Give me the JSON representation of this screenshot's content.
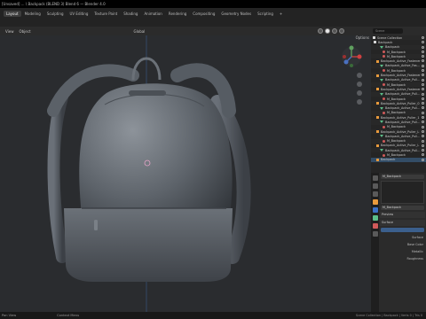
{
  "titlebar": {
    "text": "[Unsaved] ... \\ Backpack (BLEND 3) Blend 6 — Blender 4.0"
  },
  "workspaces": [
    "Layout",
    "Modeling",
    "Sculpting",
    "UV Editing",
    "Texture Paint",
    "Shading",
    "Animation",
    "Rendering",
    "Compositing",
    "Geometry Nodes",
    "Scripting",
    "+"
  ],
  "active_workspace": "Layout",
  "context": {
    "view": "View",
    "object": "Object",
    "orientation": "Global",
    "options": "Options"
  },
  "outliner": {
    "search_placeholder": "Scene",
    "rows": [
      {
        "label": "Scene Collection",
        "icon": "collection-icon",
        "selected": false
      },
      {
        "label": "Backpack",
        "icon": "collection-icon",
        "selected": false
      },
      {
        "label": "Backpack",
        "icon": "mesh-icon",
        "selected": false
      },
      {
        "label": "M_Backpack",
        "icon": "material-icon",
        "selected": false
      },
      {
        "label": "M_Backpack",
        "icon": "material-icon",
        "selected": false
      },
      {
        "label": "Backpack_Active_Fastener",
        "icon": "object-icon",
        "selected": false
      },
      {
        "label": "Backpack_Active_Fas...",
        "icon": "mesh-icon",
        "selected": false
      },
      {
        "label": "M_Backpack",
        "icon": "material-icon",
        "selected": false
      },
      {
        "label": "Backpack_Active_Fastener",
        "icon": "object-icon",
        "selected": false
      },
      {
        "label": "Backpack_Active_Pull...",
        "icon": "mesh-icon",
        "selected": false
      },
      {
        "label": "M_Backpack",
        "icon": "material-icon",
        "selected": false
      },
      {
        "label": "Backpack_Active_Fastener",
        "icon": "object-icon",
        "selected": false
      },
      {
        "label": "Backpack_Active_Pull...",
        "icon": "mesh-icon",
        "selected": false
      },
      {
        "label": "M_Backpack",
        "icon": "material-icon",
        "selected": false
      },
      {
        "label": "Backpack_Active_Puller_0",
        "icon": "object-icon",
        "selected": false
      },
      {
        "label": "Backpack_Active_Pull...",
        "icon": "mesh-icon",
        "selected": false
      },
      {
        "label": "M_Backpack",
        "icon": "material-icon",
        "selected": false
      },
      {
        "label": "Backpack_Active_Puller_1",
        "icon": "object-icon",
        "selected": false
      },
      {
        "label": "Backpack_Active_Pull...",
        "icon": "mesh-icon",
        "selected": false
      },
      {
        "label": "M_Backpack",
        "icon": "material-icon",
        "selected": false
      },
      {
        "label": "Backpack_Active_Puller_L",
        "icon": "object-icon",
        "selected": false
      },
      {
        "label": "Backpack_Active_Pull...",
        "icon": "mesh-icon",
        "selected": false
      },
      {
        "label": "M_Backpack",
        "icon": "material-icon",
        "selected": false
      },
      {
        "label": "Backpack_Active_Puller_L",
        "icon": "object-icon",
        "selected": false
      },
      {
        "label": "Backpack_Active_Pull...",
        "icon": "mesh-icon",
        "selected": false
      },
      {
        "label": "M_Backpack",
        "icon": "material-icon",
        "selected": false
      },
      {
        "label": "Backpack",
        "icon": "object-icon",
        "selected": true
      }
    ]
  },
  "properties": {
    "object_name": "M_Backpack",
    "material_name": "M_Backpack",
    "preview_label": "Preview",
    "surface_label": "Surface",
    "surface_value": "",
    "fields": [
      "Surface",
      "Base Color",
      "Metallic",
      "Roughness"
    ]
  },
  "status": {
    "left": "Pan View",
    "middle": "Context Menu",
    "right": "Scene Collection | Backpack | Verts 0 | Tris 0"
  }
}
